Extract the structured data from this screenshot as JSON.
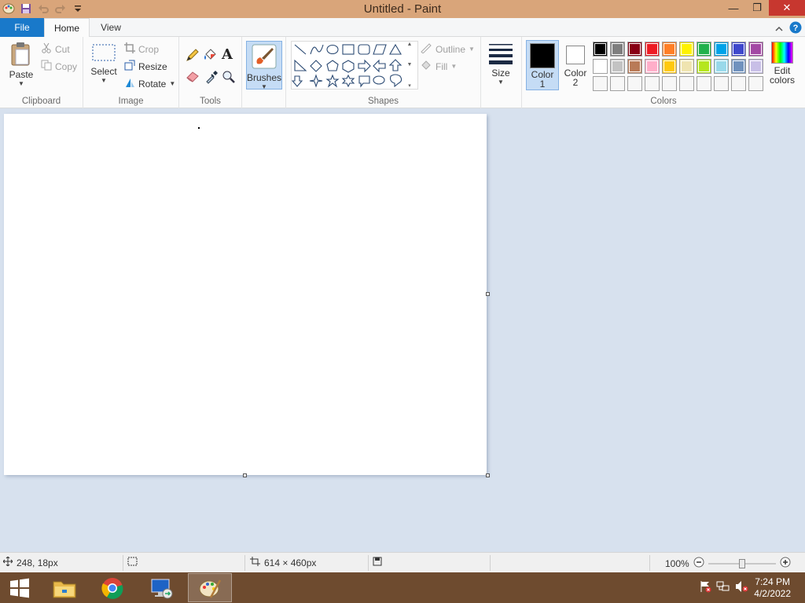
{
  "window": {
    "title": "Untitled - Paint"
  },
  "tabs": {
    "file": "File",
    "home": "Home",
    "view": "View"
  },
  "clipboard": {
    "paste": "Paste",
    "cut": "Cut",
    "copy": "Copy",
    "label": "Clipboard"
  },
  "image": {
    "select": "Select",
    "crop": "Crop",
    "resize": "Resize",
    "rotate": "Rotate",
    "label": "Image"
  },
  "tools": {
    "label": "Tools"
  },
  "brushes": {
    "label": "Brushes"
  },
  "shapes": {
    "outline": "Outline",
    "fill": "Fill",
    "label": "Shapes"
  },
  "size": {
    "label": "Size"
  },
  "color1": {
    "label": "Color",
    "num": "1",
    "value": "#000000"
  },
  "color2": {
    "label": "Color",
    "num": "2",
    "value": "#ffffff"
  },
  "colors": {
    "label": "Colors",
    "edit_label_1": "Edit",
    "edit_label_2": "colors",
    "row1": [
      "#000000",
      "#7f7f7f",
      "#880015",
      "#ed1c24",
      "#ff7f27",
      "#fff200",
      "#22b14c",
      "#00a2e8",
      "#3f48cc",
      "#a349a4"
    ],
    "row2": [
      "#ffffff",
      "#c3c3c3",
      "#b97a57",
      "#ffaec9",
      "#ffc90e",
      "#efe4b0",
      "#b5e61d",
      "#99d9ea",
      "#7092be",
      "#c8bfe7"
    ]
  },
  "status": {
    "cursor_pos": "248, 18px",
    "canvas_size": "614 × 460px",
    "zoom": "100%",
    "zoom_level": 1.0
  },
  "taskbar": {
    "time": "7:24 PM",
    "date": "4/2/2022"
  }
}
